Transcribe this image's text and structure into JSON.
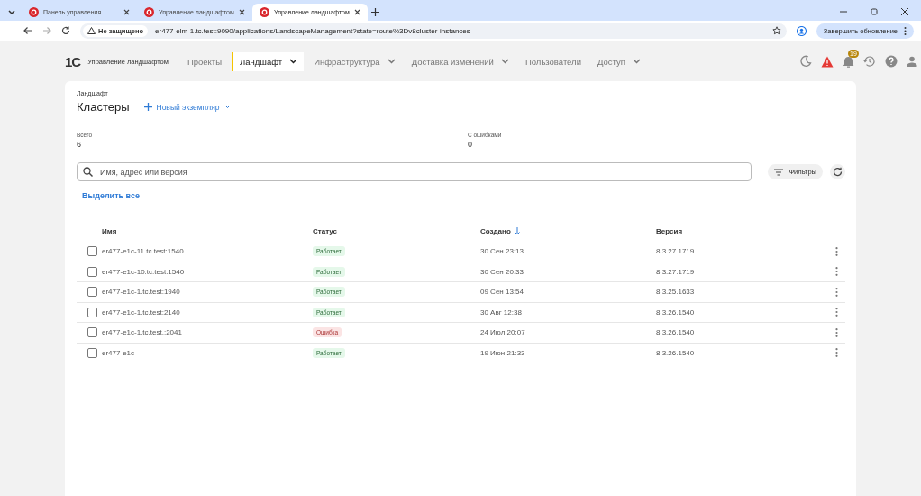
{
  "browser": {
    "tabs": [
      {
        "title": "Панель управления",
        "selected": false
      },
      {
        "title": "Управление ландшафтом",
        "selected": false
      },
      {
        "title": "Управление ландшафтом",
        "selected": true
      }
    ],
    "security": "Не защищено",
    "url": "er477-elm-1.tc.test:9090/applications/LandscapeManagement?state=route%3Dv8cluster-instances",
    "update_button": "Завершить обновление"
  },
  "app": {
    "logo": "1С",
    "product": "Управление ландшафтом",
    "nav": [
      {
        "label": "Проекты",
        "selected": false,
        "dropdown": false
      },
      {
        "label": "Ландшафт",
        "selected": true,
        "dropdown": true
      },
      {
        "label": "Инфраструктура",
        "selected": false,
        "dropdown": true
      },
      {
        "label": "Доставка изменений",
        "selected": false,
        "dropdown": true
      },
      {
        "label": "Пользователи",
        "selected": false,
        "dropdown": false
      },
      {
        "label": "Доступ",
        "selected": false,
        "dropdown": true
      }
    ],
    "notifications_badge": "19"
  },
  "page": {
    "breadcrumb": "Ландшафт",
    "title": "Кластеры",
    "new_button": "Новый экземпляр",
    "stats": [
      {
        "label": "Всего",
        "value": "6"
      },
      {
        "label": "С ошибками",
        "value": "0"
      }
    ],
    "search": {
      "placeholder": "Имя, адрес или версия"
    },
    "filters_button": "Фильтры",
    "select_all": "Выделить все"
  },
  "table": {
    "columns": [
      "Имя",
      "Статус",
      "Создано",
      "Версия"
    ],
    "rows": [
      {
        "name": "er477-e1c-11.tc.test:1540",
        "status": "Работает",
        "kind": "ok",
        "created": "30 Сен 23:13",
        "version": "8.3.27.1719",
        "checked": false
      },
      {
        "name": "er477-e1c-10.tc.test:1540",
        "status": "Работает",
        "kind": "ok",
        "created": "30 Сен 20:33",
        "version": "8.3.27.1719",
        "checked": false
      },
      {
        "name": "er477-e1c-1.tc.test:1940",
        "status": "Работает",
        "kind": "ok",
        "created": "09 Сен 13:54",
        "version": "8.3.25.1633",
        "checked": false
      },
      {
        "name": "er477-e1c-1.tc.test:2140",
        "status": "Работает",
        "kind": "ok",
        "created": "30 Авг 12:38",
        "version": "8.3.26.1540",
        "checked": false
      },
      {
        "name": "er477-e1c-1.tc.test.:2041",
        "status": "Ошибка",
        "kind": "error",
        "created": "24 Июл 20:07",
        "version": "8.3.26.1540",
        "checked": false
      },
      {
        "name": "er477-e1c",
        "status": "Работает",
        "kind": "ok",
        "created": "19 Июн 21:33",
        "version": "8.3.26.1540",
        "checked": false
      }
    ]
  }
}
